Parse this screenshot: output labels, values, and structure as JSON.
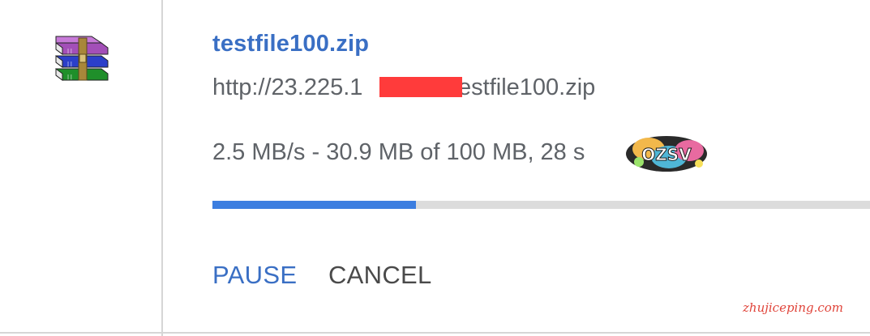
{
  "download": {
    "file_icon": "winrar-archive-icon",
    "file_name": "testfile100.zip",
    "url": "http://23.225.1       /testfile100.zip",
    "status": "2.5 MB/s - 30.9 MB of 100 MB, 28 s       t",
    "progress_fraction": 0.309,
    "progress_color": "#3c7ee0",
    "progress_track_color": "#dcdcdc"
  },
  "actions": {
    "pause_label": "PAUSE",
    "cancel_label": "CANCEL"
  },
  "colors": {
    "link_blue": "#3a6fc4",
    "text_gray": "#5f6368",
    "redaction_red": "#ff3b3b"
  },
  "watermarks": {
    "sticker_text": "OZSV",
    "site": "zhujiceping.com"
  }
}
